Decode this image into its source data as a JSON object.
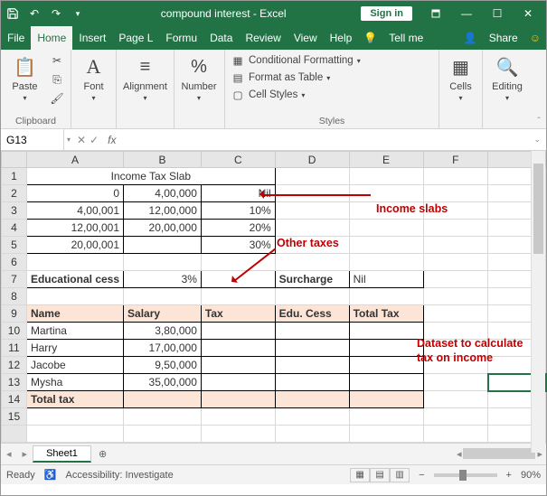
{
  "titlebar": {
    "title": "compound interest - Excel",
    "signin": "Sign in"
  },
  "menu": {
    "file": "File",
    "home": "Home",
    "insert": "Insert",
    "pagel": "Page L",
    "formu": "Formu",
    "data": "Data",
    "review": "Review",
    "view": "View",
    "help": "Help",
    "tellme": "Tell me",
    "share": "Share"
  },
  "ribbon": {
    "paste": "Paste",
    "clipboard": "Clipboard",
    "font": "Font",
    "alignment": "Alignment",
    "number": "Number",
    "condfmt": "Conditional Formatting",
    "fmttable": "Format as Table",
    "cellstyles": "Cell Styles",
    "styles": "Styles",
    "cells": "Cells",
    "editing": "Editing"
  },
  "fbar": {
    "name": "G13",
    "fx": "fx"
  },
  "cols": [
    "A",
    "B",
    "C",
    "D",
    "E",
    "F"
  ],
  "sheet": {
    "title": "Income Tax Slab",
    "slab": [
      {
        "a": "0",
        "b": "4,00,000",
        "c": "Nil"
      },
      {
        "a": "4,00,001",
        "b": "12,00,000",
        "c": "10%"
      },
      {
        "a": "12,00,001",
        "b": "20,00,000",
        "c": "20%"
      },
      {
        "a": "20,00,001",
        "b": "",
        "c": "30%"
      }
    ],
    "edu_label": "Educational cess",
    "edu_val": "3%",
    "sur_label": "Surcharge",
    "sur_val": "Nil",
    "hdr": {
      "a": "Name",
      "b": "Salary",
      "c": "Tax",
      "d": "Edu. Cess",
      "e": "Total Tax"
    },
    "rows": [
      {
        "a": "Martina",
        "b": "3,80,000"
      },
      {
        "a": "Harry",
        "b": "17,00,000"
      },
      {
        "a": "Jacobe",
        "b": "9,50,000"
      },
      {
        "a": "Mysha",
        "b": "35,00,000"
      }
    ],
    "total": "Total tax"
  },
  "anno": {
    "slabs": "Income slabs",
    "other": "Other taxes",
    "dataset": "Dataset to calculate tax on income"
  },
  "tabs": {
    "sheet1": "Sheet1"
  },
  "status": {
    "ready": "Ready",
    "access": "Accessibility: Investigate",
    "zoom": "90%"
  }
}
